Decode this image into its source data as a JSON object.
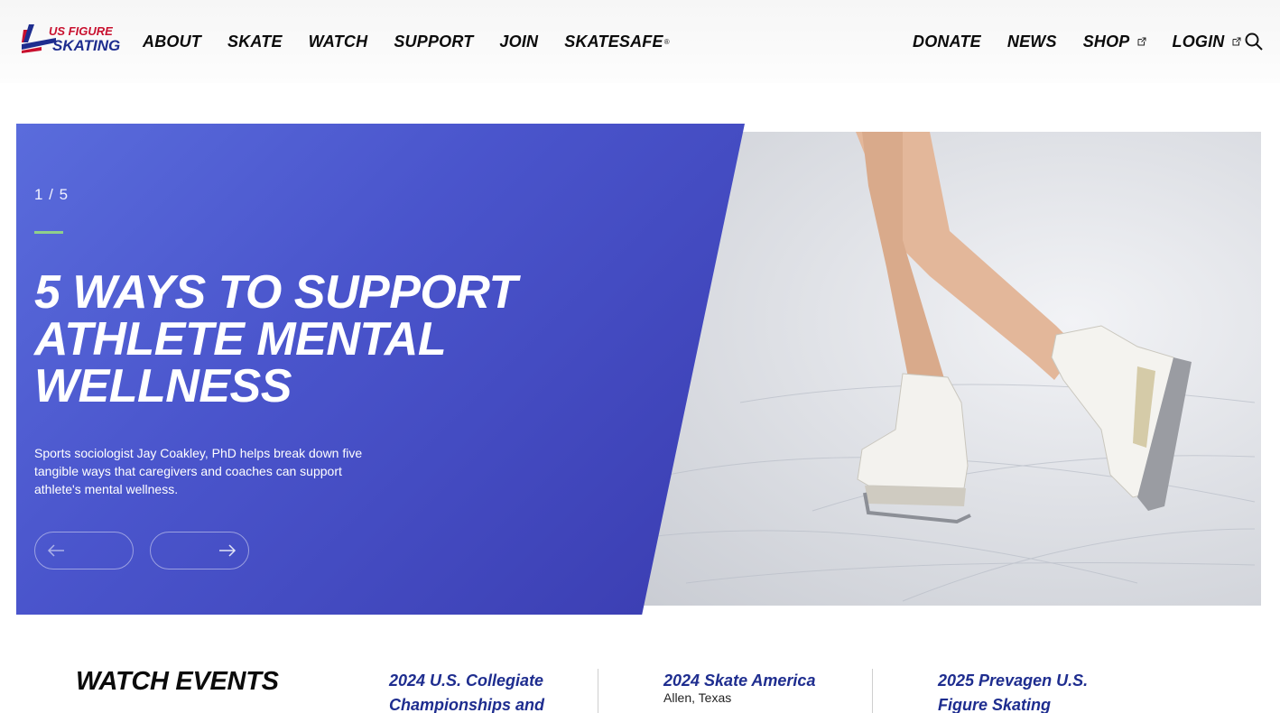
{
  "logo": {
    "text": "US FIGURE SKATING"
  },
  "nav": {
    "left": [
      {
        "label": "ABOUT"
      },
      {
        "label": "SKATE"
      },
      {
        "label": "WATCH"
      },
      {
        "label": "SUPPORT"
      },
      {
        "label": "JOIN"
      },
      {
        "label": "SKATESAFE",
        "sup": "®"
      }
    ],
    "right": [
      {
        "label": "DONATE"
      },
      {
        "label": "NEWS"
      },
      {
        "label": "SHOP",
        "icon": "external-link-icon"
      },
      {
        "label": "LOGIN",
        "icon": "external-link-icon"
      }
    ],
    "search_icon": "search-icon"
  },
  "hero": {
    "counter": "1 / 5",
    "title": "5 WAYS TO SUPPORT ATHLETE MENTAL WELLNESS",
    "description": "Sports sociologist Jay Coakley, PhD helps break down five tangible ways that caregivers and coaches can support athlete's mental wellness.",
    "prev_icon": "arrow-left-icon",
    "next_icon": "arrow-right-icon",
    "accent_color": "#8fd08a",
    "panel_color": "#4a55cc"
  },
  "watch": {
    "title": "WATCH EVENTS",
    "events": [
      {
        "title": "2024 U.S. Collegiate Championships and",
        "location": ""
      },
      {
        "title": "2024 Skate America",
        "location": "Allen, Texas"
      },
      {
        "title": "2025 Prevagen U.S. Figure Skating",
        "location": ""
      }
    ]
  },
  "colors": {
    "nav_text": "#0b0b0b",
    "event_title": "#1e2d8f"
  }
}
